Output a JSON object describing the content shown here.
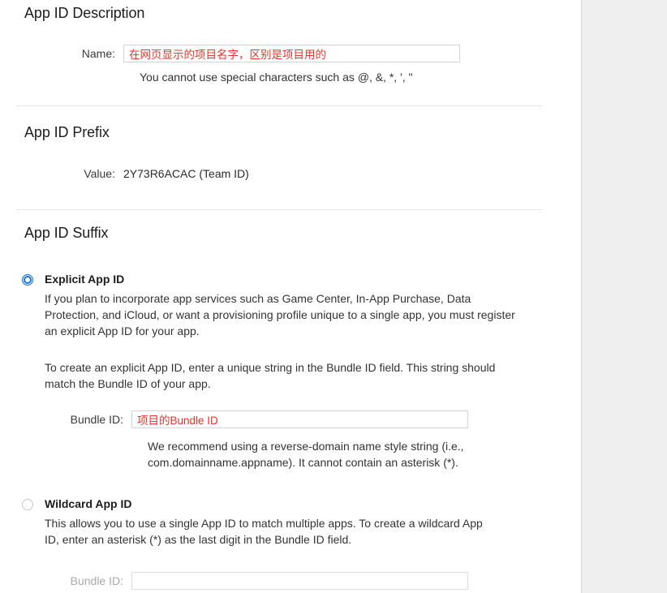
{
  "page": {
    "accent_color": "#1572e8",
    "value_text_color": "#e8342a",
    "background": "#ffffff",
    "side_panel_color": "#efeff0"
  },
  "sections": {
    "description": {
      "heading": "App ID Description",
      "name_label": "Name:",
      "name_value": "在网页显示的项目名字，区别是项目用的",
      "name_placeholder": "",
      "name_hint": "You cannot use special characters such as @, &, *, ', \""
    },
    "prefix": {
      "heading": "App ID Prefix",
      "value_label": "Value:",
      "value_text": "2Y73R6ACAC (Team ID)"
    },
    "suffix": {
      "heading": "App ID Suffix",
      "explicit": {
        "title": "Explicit App ID",
        "paragraph1": "If you plan to incorporate app services such as Game Center, In-App Purchase, Data Protection, and iCloud, or want a provisioning profile unique to a single app, you must register an explicit App ID for your app.",
        "paragraph2": "To create an explicit App ID, enter a unique string in the Bundle ID field. This string should match the Bundle ID of your app.",
        "bundle_label": "Bundle ID:",
        "bundle_value": "项目的Bundle ID",
        "bundle_placeholder": "",
        "bundle_hint": "We recommend using a reverse-domain name style string (i.e., com.domainname.appname). It cannot contain an asterisk (*).",
        "selected": "true"
      },
      "wildcard": {
        "title": "Wildcard App ID",
        "paragraph1": "This allows you to use a single App ID to match multiple apps. To create a wildcard App ID, enter an asterisk (*) as the last digit in the Bundle ID field.",
        "bundle_label": "Bundle ID:",
        "bundle_value": "",
        "bundle_placeholder": "",
        "selected": "false"
      }
    }
  }
}
